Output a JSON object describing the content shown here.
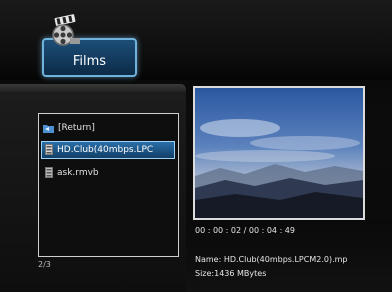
{
  "category": {
    "label": "Films",
    "icon": "film-reel-clapper-icon"
  },
  "file_list": {
    "items": [
      {
        "label": "[Return]",
        "icon": "folder-return-icon",
        "selected": false
      },
      {
        "label": "HD.Club(40mbps.LPC",
        "icon": "video-file-icon",
        "selected": true
      },
      {
        "label": "ask.rmvb",
        "icon": "video-file-icon",
        "selected": false
      }
    ],
    "page_indicator": "2/3"
  },
  "preview": {
    "time": "00 : 00 : 02 / 00 : 04 : 49",
    "name": "Name: HD.Club(40mbps.LPCM2.0).mp",
    "size": "Size:1436 MBytes"
  },
  "colors": {
    "accent": "#2a6ea8",
    "accent_border": "#9fd2f7",
    "sky_top": "#2f5fa6",
    "sky_bottom": "#b7c4d6"
  }
}
